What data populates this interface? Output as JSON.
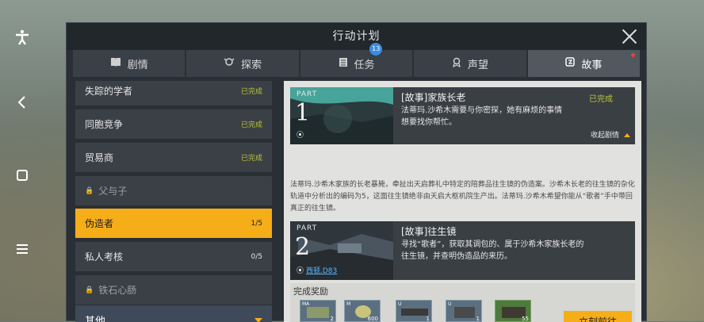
{
  "window": {
    "title": "行动计划"
  },
  "tabs": [
    {
      "label": "剧情",
      "icon": "book-icon"
    },
    {
      "label": "探索",
      "icon": "explore-icon"
    },
    {
      "label": "任务",
      "icon": "clipboard-icon",
      "badge": "13"
    },
    {
      "label": "声望",
      "icon": "award-icon"
    },
    {
      "label": "故事",
      "icon": "story-icon",
      "active": true
    }
  ],
  "list": {
    "items": [
      {
        "label": "失踪的学者",
        "status": "已完成"
      },
      {
        "label": "同胞竞争",
        "status": "已完成"
      },
      {
        "label": "贸易商",
        "status": "已完成"
      },
      {
        "label": "父与子",
        "locked": true
      },
      {
        "label": "伪造者",
        "status": "1/5",
        "selected": true
      },
      {
        "label": "私人考核",
        "status": "0/5"
      },
      {
        "label": "铁石心肠",
        "locked": true
      }
    ],
    "section": "其他"
  },
  "detail": {
    "part1": {
      "part": "PART",
      "num": "1",
      "title": "[故事]家族长老",
      "status": "已完成",
      "desc": "法蒂玛.沙希木需要与你密探，她有麻烦的事情想要找你帮忙。",
      "fold": "收起剧情"
    },
    "story": "法蒂玛.沙希木家族的长老暴毙，牵扯出天启葬礼中特定的陪葬品往生镜的伪造案。沙希木长老的往生镜的杂化轨道中分析出的编码为5，这面往生镜绝非由天启大枢机院生产出。法蒂玛.沙希木希望你能从“歌者”手中带回真正的往生镜。",
    "part2": {
      "part": "PART",
      "num": "2",
      "title": "[故事]往生镜",
      "desc": "寻找“歌者”，获取其调包的、属于沙希木家族长老的往生镜，并查明伪造品的来历。",
      "location": "西顿.D83"
    },
    "reward": {
      "title": "完成奖励",
      "items": [
        {
          "type": "MA",
          "count": "2"
        },
        {
          "type": "M",
          "count": "600"
        },
        {
          "type": "U",
          "count": "1"
        },
        {
          "type": "U",
          "count": "1"
        },
        {
          "type": "",
          "count": "55"
        }
      ],
      "go": "立刻前往"
    }
  },
  "colors": {
    "accent": "#f5ad18",
    "done": "#b9c43b",
    "badge": "#3a8de0"
  }
}
